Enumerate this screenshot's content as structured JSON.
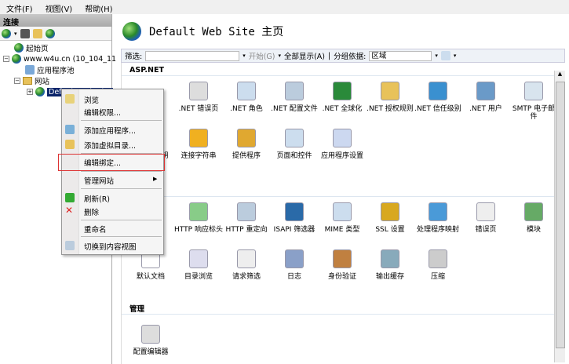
{
  "menubar": [
    "文件(F)",
    "视图(V)",
    "帮助(H)"
  ],
  "connections": {
    "header": "连接",
    "tree": {
      "start_page": "起始页",
      "server": "www.w4u.cn (10_104_11_",
      "app_pools": "应用程序池",
      "sites": "网站",
      "site": "Default Web Site"
    }
  },
  "main": {
    "title": "Default Web Site 主页",
    "filter": {
      "label": "筛选:",
      "value": "",
      "go": "开始(G)",
      "show_all": "全部显示(A)",
      "group_by_label": "分组依据:",
      "group_by_value": "区域"
    },
    "sections": {
      "aspnet": "ASP.NET",
      "manage": "管理"
    },
    "aspnet_row1": [
      ".NET 错误页",
      ".NET 角色",
      ".NET 配置文件",
      ".NET 全球化",
      ".NET 授权规则",
      ".NET 信任级别",
      ".NET 用户",
      "SMTP 电子邮件"
    ],
    "aspnet_row2": [
      "计算机密钥",
      "连接字符串",
      "提供程序",
      "页面和控件",
      "应用程序设置"
    ],
    "iis_row1": [
      "HTTP 响应标头",
      "HTTP 重定向",
      "ISAPI 筛选器",
      "MIME 类型",
      "SSL 设置",
      "处理程序映射",
      "错误页",
      "模块"
    ],
    "iis_row2": [
      "默认文档",
      "目录浏览",
      "请求筛选",
      "日志",
      "身份验证",
      "输出缓存",
      "压缩"
    ],
    "manage_row": [
      "配置编辑器"
    ]
  },
  "context_menu": {
    "browse": "浏览",
    "edit_permissions": "编辑权限...",
    "add_application": "添加应用程序...",
    "add_virtual_dir": "添加虚拟目录...",
    "edit_bindings": "编辑绑定...",
    "manage_site": "管理网站",
    "refresh": "刷新(R)",
    "delete": "删除",
    "rename": "重命名",
    "switch_content_view": "切换到内容视图"
  },
  "colors": {
    "selection": "#0a246a",
    "highlight_box": "#dd3333"
  }
}
